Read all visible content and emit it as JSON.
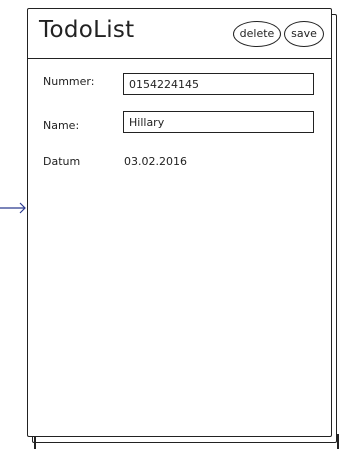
{
  "header": {
    "title": "TodoList",
    "delete_label": "delete",
    "save_label": "save"
  },
  "form": {
    "number": {
      "label": "Nummer:",
      "value": "0154224145"
    },
    "name": {
      "label": "Name:",
      "value": "Hillary"
    },
    "date": {
      "label": "Datum",
      "value": "03.02.2016"
    }
  },
  "icons": {
    "arrow": "arrow-right-icon"
  },
  "colors": {
    "stroke": "#222222",
    "arrow": "#2b3a8f"
  }
}
